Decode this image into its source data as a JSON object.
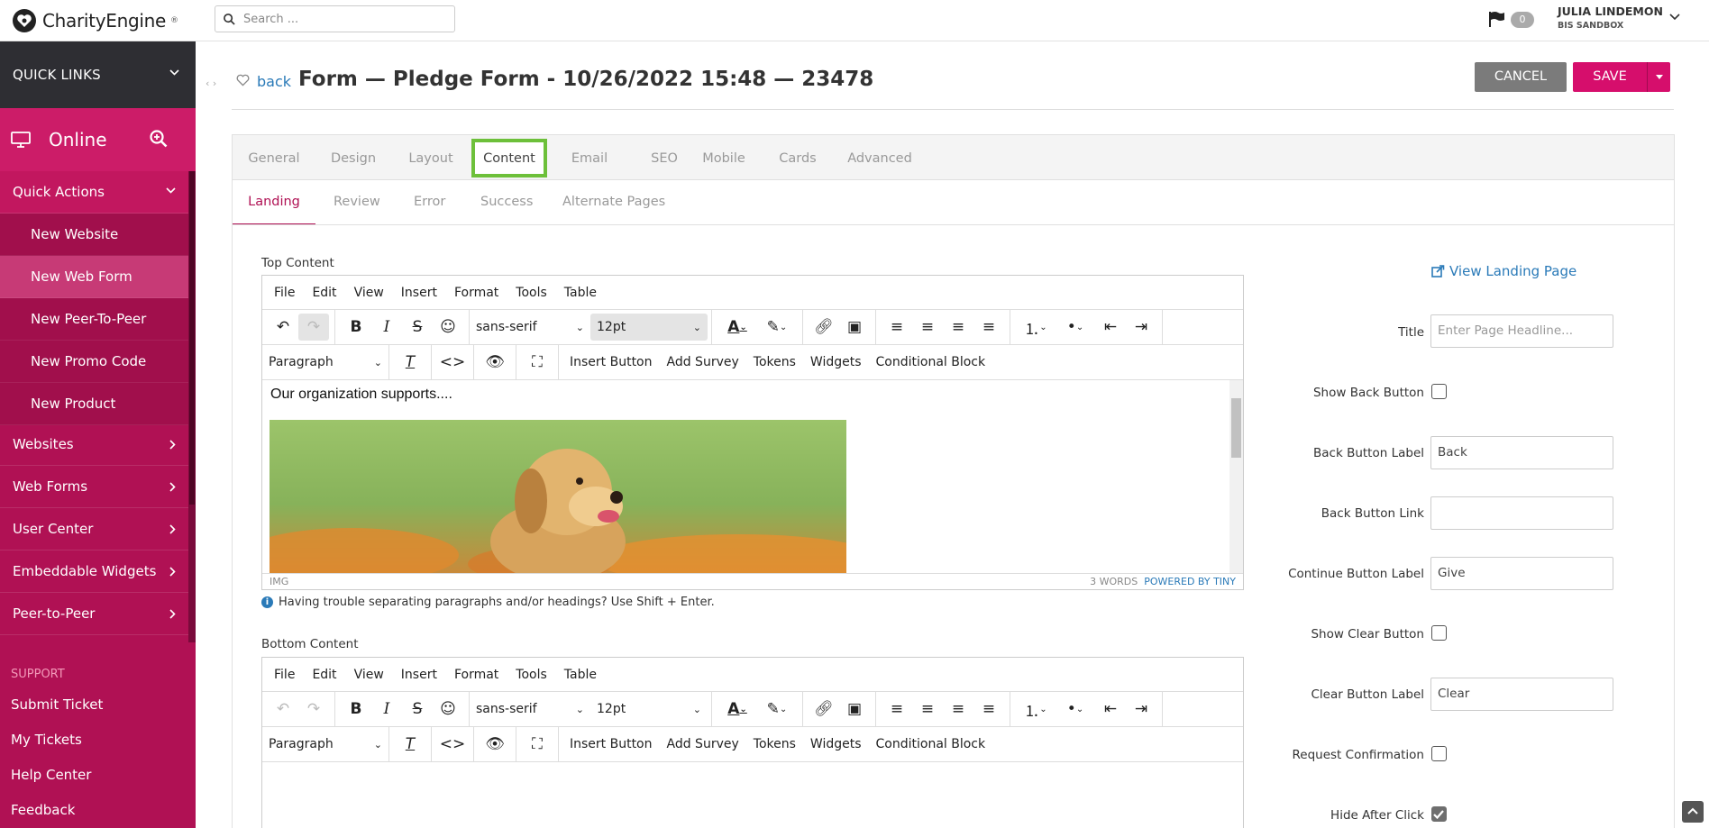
{
  "brand": {
    "name": "CharityEngine",
    "trademark": "®"
  },
  "search": {
    "placeholder": "Search ..."
  },
  "header": {
    "flag_count": "0",
    "user_name": "JULIA LINDEMON",
    "user_org": "BIS SANDBOX"
  },
  "sidebar": {
    "quick_links": "QUICK LINKS",
    "online": "Online",
    "quick_actions": "Quick Actions",
    "sub_items": [
      "New Website",
      "New Web Form",
      "New Peer-To-Peer",
      "New Promo Code",
      "New Product"
    ],
    "sections": [
      "Websites",
      "Web Forms",
      "User Center",
      "Embeddable Widgets",
      "Peer-to-Peer"
    ],
    "support_heading": "SUPPORT",
    "support_links": [
      "Submit Ticket",
      "My Tickets",
      "Help Center",
      "Feedback"
    ]
  },
  "page": {
    "back": "back",
    "title": "Form — Pledge Form - 10/26/2022 15:48 — 23478",
    "cancel": "CANCEL",
    "save": "SAVE"
  },
  "tabs": [
    "General",
    "Design",
    "Layout",
    "Content",
    "Email",
    "SEO",
    "Mobile",
    "Cards",
    "Advanced"
  ],
  "active_tab": "Content",
  "subtabs": [
    "Landing",
    "Review",
    "Error",
    "Success",
    "Alternate Pages"
  ],
  "active_subtab": "Landing",
  "editor": {
    "menu": [
      "File",
      "Edit",
      "View",
      "Insert",
      "Format",
      "Tools",
      "Table"
    ],
    "font_family": "sans-serif",
    "font_size": "12pt",
    "block_format": "Paragraph",
    "custom_buttons": [
      "Insert Button",
      "Add Survey",
      "Tokens",
      "Widgets",
      "Conditional Block"
    ]
  },
  "top_content": {
    "label": "Top Content",
    "text": "Our organization supports....",
    "status_path": "IMG",
    "word_count": "3 WORDS",
    "powered_by": "POWERED BY TINY"
  },
  "hint": "Having trouble separating paragraphs and/or headings? Use Shift + Enter.",
  "bottom_content": {
    "label": "Bottom Content"
  },
  "right_panel": {
    "view_link": "View Landing Page",
    "title_label": "Title",
    "title_placeholder": "Enter Page Headline...",
    "show_back_label": "Show Back Button",
    "back_label_label": "Back Button Label",
    "back_label_value": "Back",
    "back_link_label": "Back Button Link",
    "back_link_value": "",
    "continue_label": "Continue Button Label",
    "continue_value": "Give",
    "show_clear_label": "Show Clear Button",
    "clear_label_label": "Clear Button Label",
    "clear_label_value": "Clear",
    "request_conf_label": "Request Confirmation",
    "hide_after_label": "Hide After Click",
    "hide_after_checked": true
  },
  "colors": {
    "brand": "#b01154",
    "accent_green": "#6dc03a",
    "save": "#d60e6c",
    "link": "#2a7ab8"
  }
}
